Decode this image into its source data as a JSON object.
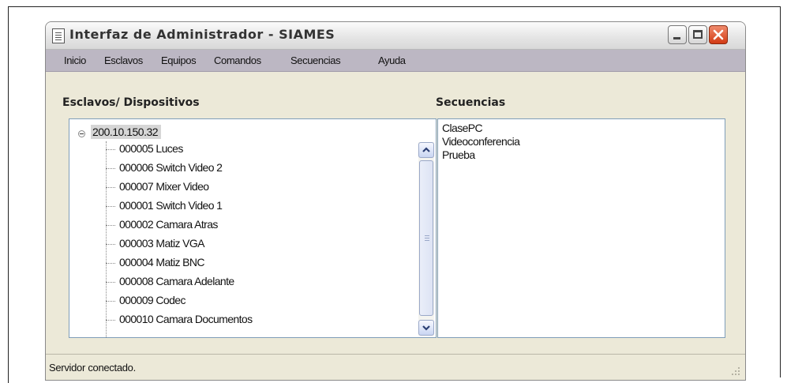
{
  "window": {
    "title": "Interfaz de Administrador - SIAMES",
    "controls": [
      "minimize-icon",
      "maximize-icon",
      "close-icon"
    ]
  },
  "menu": [
    "Inicio",
    "Esclavos",
    "Equipos",
    "Comandos",
    "Secuencias",
    "Ayuda"
  ],
  "left_panel": {
    "label": "Esclavos/ Dispositivos",
    "root": "200.10.150.32",
    "items": [
      "000005 Luces",
      "000006 Switch Video 2",
      "000007 Mixer Video",
      "000001 Switch Video 1",
      "000002 Camara Atras",
      "000003 Matiz VGA",
      "000004 Matiz BNC",
      "000008 Camara Adelante",
      "000009 Codec",
      "000010 Camara Documentos"
    ]
  },
  "right_panel": {
    "label": "Secuencias",
    "items": [
      "ClasePC",
      "Videoconferencia",
      "Prueba"
    ]
  },
  "status": {
    "text": "Servidor conectado."
  },
  "colors": {
    "window_bg": "#ece9d8",
    "menubar_bg": "#bcb7c3",
    "close_button": "#d23a14",
    "selection_bg": "#d6d6d6"
  }
}
